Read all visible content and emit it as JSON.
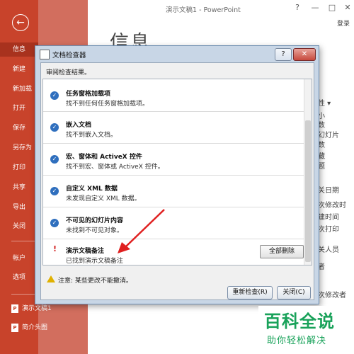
{
  "app": {
    "title": "演示文稿1 - PowerPoint",
    "login": "登录",
    "window_controls": [
      "?",
      "—",
      "□",
      "✕"
    ]
  },
  "sidebar": {
    "back_icon": "back-arrow-icon",
    "items": [
      {
        "label": "信息",
        "active": true
      },
      {
        "label": "新建"
      },
      {
        "label": "新加载"
      },
      {
        "label": "打开"
      },
      {
        "label": "保存"
      },
      {
        "label": "另存为"
      },
      {
        "label": "打印"
      },
      {
        "label": "共享"
      },
      {
        "label": "导出"
      },
      {
        "label": "关闭"
      },
      {
        "label": "帐户"
      },
      {
        "label": "选项"
      }
    ],
    "recent": [
      "演示文稿1",
      "简介头图"
    ]
  },
  "backstage": {
    "heading": "信息",
    "right_fragments": [
      "性 ▾",
      "小",
      "数",
      "幻灯片",
      "数",
      "藏",
      "题",
      "关日期",
      "次修改时",
      "建时间",
      "次打印",
      "关人员",
      "者",
      "次修改者"
    ]
  },
  "dialog": {
    "title": "文档检查器",
    "help": "?",
    "close": "✕",
    "instruction": "审阅检查结果。",
    "results": [
      {
        "status": "ok",
        "title": "任务窗格加载项",
        "desc": "找不到任何任务窗格加载项。"
      },
      {
        "status": "ok",
        "title": "嵌入文档",
        "desc": "找不到嵌入文档。"
      },
      {
        "status": "ok",
        "title": "宏、窗体和 ActiveX 控件",
        "desc": "找不到宏、窗体或 ActiveX 控件。"
      },
      {
        "status": "ok",
        "title": "自定义 XML 数据",
        "desc": "未发现自定义 XML 数据。"
      },
      {
        "status": "ok",
        "title": "不可见的幻灯片内容",
        "desc": "未找到不可见对象。"
      },
      {
        "status": "found",
        "title": "演示文稿备注",
        "desc": "已找到演示文稿备注",
        "action": "全部删除"
      }
    ],
    "note": "注意: 某些更改不能撤消。",
    "recheck_button": "重新检查(R)",
    "close_button": "关闭(C)"
  },
  "watermark": {
    "big": "百科全说",
    "small": "助你轻松解决"
  },
  "colors": {
    "sidebar": "#c8432b",
    "accent_ok": "#2f6fbe",
    "warn": "#d21f1f",
    "watermark": "#19a25a"
  }
}
